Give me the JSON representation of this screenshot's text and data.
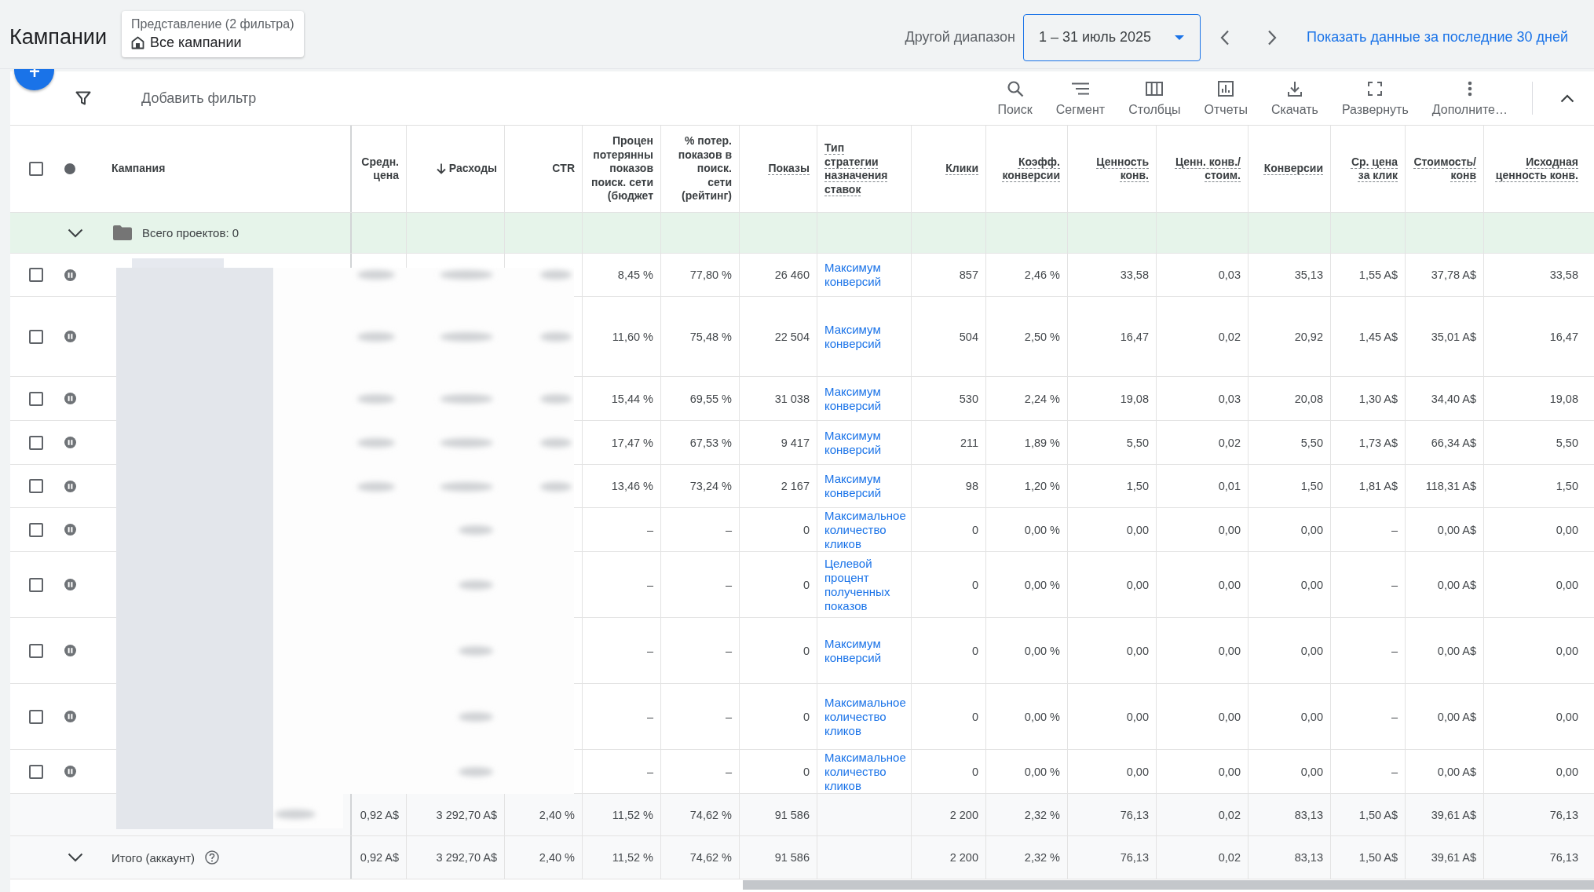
{
  "header": {
    "title": "Кампании",
    "view": {
      "caption": "Представление (2 фильтра)",
      "value": "Все кампании"
    },
    "range_label": "Другой диапазон",
    "date_range": "1 – 31 июль 2025",
    "link": "Показать данные за последние 30 дней"
  },
  "toolbar": {
    "filter_label": "Добавить фильтр",
    "actions": [
      {
        "kind": "search",
        "label": "Поиск"
      },
      {
        "kind": "segment",
        "label": "Сегмент"
      },
      {
        "kind": "columns",
        "label": "Столбцы"
      },
      {
        "kind": "reports",
        "label": "Отчеты"
      },
      {
        "kind": "download",
        "label": "Скачать"
      },
      {
        "kind": "expand",
        "label": "Развернуть"
      },
      {
        "kind": "more",
        "label": "Дополните…"
      }
    ],
    "expanded": true
  },
  "table": {
    "select_all_checked": false,
    "campaign_header": "Кампания",
    "columns": [
      {
        "label": "Средн.\nцена",
        "kind": "number",
        "underlined": false,
        "sorted": false
      },
      {
        "label": "Расходы",
        "kind": "number",
        "underlined": false,
        "sorted": true
      },
      {
        "label": "CTR",
        "kind": "number",
        "underlined": false,
        "sorted": false
      },
      {
        "label": "Процен\nпотерянны\nпоказов\nпоиск. сети\n(бюджет",
        "kind": "number",
        "underlined": false,
        "sorted": false
      },
      {
        "label": "% потер.\nпоказов в\nпоиск.\nсети\n(рейтинг)",
        "kind": "number",
        "underlined": false,
        "sorted": false
      },
      {
        "label": "Показы",
        "kind": "number",
        "underlined": true,
        "sorted": false
      },
      {
        "label": "Тип\nстратегии\nназначения\nставок",
        "kind": "link",
        "underlined": true,
        "sorted": false
      },
      {
        "label": "Клики",
        "kind": "number",
        "underlined": true,
        "sorted": false
      },
      {
        "label": "Коэфф.\nконверсии",
        "kind": "number",
        "underlined": true,
        "sorted": false
      },
      {
        "label": "Ценность\nконв.",
        "kind": "number",
        "underlined": true,
        "sorted": false
      },
      {
        "label": "Ценн. конв./\nстоим.",
        "kind": "number",
        "underlined": true,
        "sorted": false
      },
      {
        "label": "Конверсии",
        "kind": "number",
        "underlined": true,
        "sorted": false
      },
      {
        "label": "Ср. цена\nза клик",
        "kind": "number",
        "underlined": true,
        "sorted": false
      },
      {
        "label": "Стоимость/\nконв",
        "kind": "number",
        "underlined": true,
        "sorted": false
      },
      {
        "label": "Исходная\nценность конв.",
        "kind": "number",
        "underlined": true,
        "sorted": false
      }
    ],
    "group_row": {
      "label": "Всего проектов: 0",
      "expanded": true
    },
    "rows": [
      {
        "checked": false,
        "paused": true,
        "cells": [
          "",
          "",
          "",
          "8,45 %",
          "77,80 %",
          "26 460",
          "Максимум конверсий",
          "857",
          "2,46 %",
          "33,58",
          "0,03",
          "35,13",
          "1,55 A$",
          "37,78 A$",
          "33,58"
        ]
      },
      {
        "checked": false,
        "paused": true,
        "cells": [
          "",
          "",
          "",
          "11,60 %",
          "75,48 %",
          "22 504",
          "Максимум конверсий",
          "504",
          "2,50 %",
          "16,47",
          "0,02",
          "20,92",
          "1,45 A$",
          "35,01 A$",
          "16,47"
        ]
      },
      {
        "checked": false,
        "paused": true,
        "cells": [
          "",
          "",
          "",
          "15,44 %",
          "69,55 %",
          "31 038",
          "Максимум конверсий",
          "530",
          "2,24 %",
          "19,08",
          "0,03",
          "20,08",
          "1,30 A$",
          "34,40 A$",
          "19,08"
        ]
      },
      {
        "checked": false,
        "paused": true,
        "cells": [
          "",
          "",
          "",
          "17,47 %",
          "67,53 %",
          "9 417",
          "Максимум конверсий",
          "211",
          "1,89 %",
          "5,50",
          "0,02",
          "5,50",
          "1,73 A$",
          "66,34 A$",
          "5,50"
        ]
      },
      {
        "checked": false,
        "paused": true,
        "cells": [
          "",
          "",
          "",
          "13,46 %",
          "73,24 %",
          "2 167",
          "Максимум конверсий",
          "98",
          "1,20 %",
          "1,50",
          "0,01",
          "1,50",
          "1,81 A$",
          "118,31 A$",
          "1,50"
        ]
      },
      {
        "checked": false,
        "paused": true,
        "cells": [
          "",
          "",
          "",
          "–",
          "–",
          "0",
          "Максимальное количество кликов",
          "0",
          "0,00 %",
          "0,00",
          "0,00",
          "0,00",
          "–",
          "0,00 A$",
          "0,00"
        ]
      },
      {
        "checked": false,
        "paused": true,
        "cells": [
          "",
          "",
          "",
          "–",
          "–",
          "0",
          "Целевой процент полученных показов",
          "0",
          "0,00 %",
          "0,00",
          "0,00",
          "0,00",
          "–",
          "0,00 A$",
          "0,00"
        ]
      },
      {
        "checked": false,
        "paused": true,
        "cells": [
          "",
          "",
          "",
          "–",
          "–",
          "0",
          "Максимум конверсий",
          "0",
          "0,00 %",
          "0,00",
          "0,00",
          "0,00",
          "–",
          "0,00 A$",
          "0,00"
        ]
      },
      {
        "checked": false,
        "paused": true,
        "cells": [
          "",
          "",
          "",
          "–",
          "–",
          "0",
          "Максимальное количество кликов",
          "0",
          "0,00 %",
          "0,00",
          "0,00",
          "0,00",
          "–",
          "0,00 A$",
          "0,00"
        ]
      },
      {
        "checked": false,
        "paused": true,
        "cells": [
          "",
          "",
          "",
          "–",
          "–",
          "0",
          "Максимальное количество кликов",
          "0",
          "0,00 %",
          "0,00",
          "0,00",
          "0,00",
          "–",
          "0,00 A$",
          "0,00"
        ]
      }
    ],
    "filtered_total": {
      "cells": [
        "0,92 A$",
        "3 292,70 A$",
        "2,40 %",
        "11,52 %",
        "74,62 %",
        "91 586",
        "",
        "2 200",
        "2,32 %",
        "76,13",
        "0,02",
        "83,13",
        "1,50 A$",
        "39,61 A$",
        "76,13"
      ]
    },
    "account_total": {
      "label": "Итого (аккаунт)",
      "expanded": true,
      "cells": [
        "0,92 A$",
        "3 292,70 A$",
        "2,40 %",
        "11,52 %",
        "74,62 %",
        "91 586",
        "",
        "2 200",
        "2,32 %",
        "76,13",
        "0,02",
        "83,13",
        "1,50 A$",
        "39,61 A$",
        "76,13"
      ]
    }
  }
}
